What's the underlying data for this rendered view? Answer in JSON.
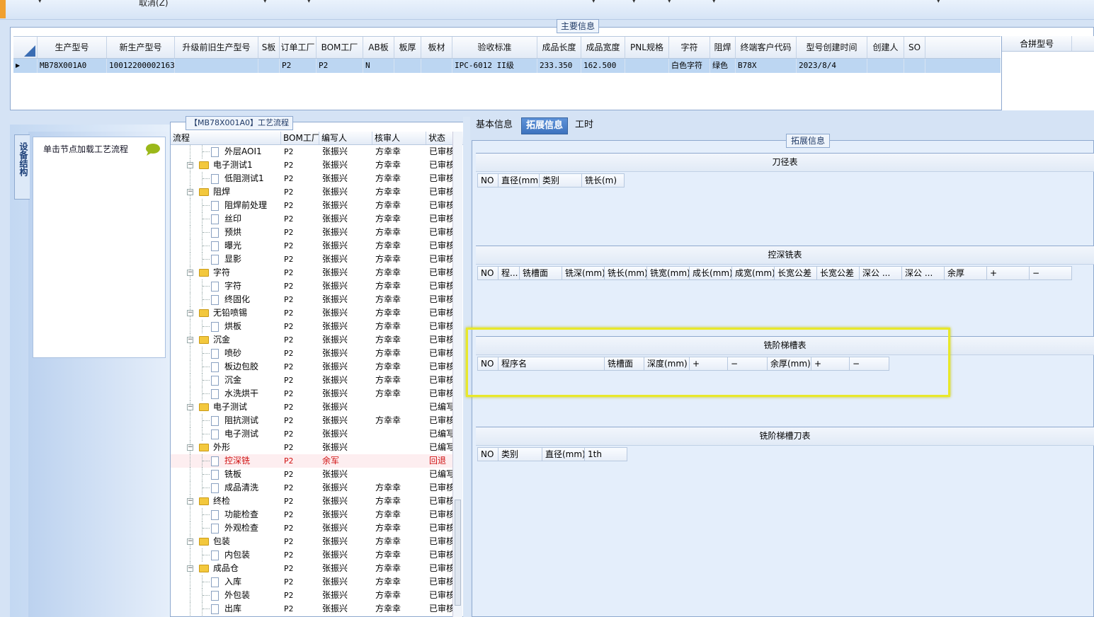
{
  "topbar": {
    "cancel_label": "取消(Z)"
  },
  "main_info": {
    "title": "主要信息",
    "columns": [
      "生产型号",
      "新生产型号",
      "升级前旧生产型号",
      "S板",
      "订单工厂",
      "BOM工厂",
      "AB板",
      "板厚",
      "板材",
      "验收标准",
      "成品长度",
      "成品宽度",
      "PNL规格",
      "字符",
      "阻焊",
      "终端客户代码",
      "型号创建时间",
      "创建人",
      "SO"
    ],
    "row": [
      "MB78X001A0",
      "10012200002163",
      "",
      "",
      "P2",
      "P2",
      "N",
      "",
      "",
      "IPC-6012 II级",
      "233.350",
      "162.500",
      "",
      "白色字符",
      "绿色",
      "B78X",
      "2023/8/4",
      "",
      ""
    ],
    "merge_header": "合拼型号"
  },
  "side": {
    "tab_label": "设备结构",
    "hint": "单击节点加载工艺流程"
  },
  "process": {
    "title": "【MB78X001A0】工艺流程",
    "columns": [
      "流程",
      "BOM工厂",
      "编写人",
      "核审人",
      "状态"
    ],
    "rows": [
      {
        "name": "外层AOI1",
        "level": 2,
        "type": "doc",
        "bom": "P2",
        "writer": "张振兴",
        "reviewer": "方幸幸",
        "status": "已审核"
      },
      {
        "name": "电子测试1",
        "level": 1,
        "type": "folder",
        "bom": "P2",
        "writer": "张振兴",
        "reviewer": "方幸幸",
        "status": "已审核"
      },
      {
        "name": "低阻测试1",
        "level": 2,
        "type": "doc",
        "bom": "P2",
        "writer": "张振兴",
        "reviewer": "方幸幸",
        "status": "已审核"
      },
      {
        "name": "阻焊",
        "level": 1,
        "type": "folder",
        "bom": "P2",
        "writer": "张振兴",
        "reviewer": "方幸幸",
        "status": "已审核"
      },
      {
        "name": "阻焊前处理",
        "level": 2,
        "type": "doc",
        "bom": "P2",
        "writer": "张振兴",
        "reviewer": "方幸幸",
        "status": "已审核"
      },
      {
        "name": "丝印",
        "level": 2,
        "type": "doc",
        "bom": "P2",
        "writer": "张振兴",
        "reviewer": "方幸幸",
        "status": "已审核"
      },
      {
        "name": "预烘",
        "level": 2,
        "type": "doc",
        "bom": "P2",
        "writer": "张振兴",
        "reviewer": "方幸幸",
        "status": "已审核"
      },
      {
        "name": "曝光",
        "level": 2,
        "type": "doc",
        "bom": "P2",
        "writer": "张振兴",
        "reviewer": "方幸幸",
        "status": "已审核"
      },
      {
        "name": "显影",
        "level": 2,
        "type": "doc",
        "bom": "P2",
        "writer": "张振兴",
        "reviewer": "方幸幸",
        "status": "已审核"
      },
      {
        "name": "字符",
        "level": 1,
        "type": "folder",
        "bom": "P2",
        "writer": "张振兴",
        "reviewer": "方幸幸",
        "status": "已审核"
      },
      {
        "name": "字符",
        "level": 2,
        "type": "doc",
        "bom": "P2",
        "writer": "张振兴",
        "reviewer": "方幸幸",
        "status": "已审核"
      },
      {
        "name": "终固化",
        "level": 2,
        "type": "doc",
        "bom": "P2",
        "writer": "张振兴",
        "reviewer": "方幸幸",
        "status": "已审核"
      },
      {
        "name": "无铅喷锡",
        "level": 1,
        "type": "folder",
        "bom": "P2",
        "writer": "张振兴",
        "reviewer": "方幸幸",
        "status": "已审核"
      },
      {
        "name": "烘板",
        "level": 2,
        "type": "doc",
        "bom": "P2",
        "writer": "张振兴",
        "reviewer": "方幸幸",
        "status": "已审核"
      },
      {
        "name": "沉金",
        "level": 1,
        "type": "folder",
        "bom": "P2",
        "writer": "张振兴",
        "reviewer": "方幸幸",
        "status": "已审核"
      },
      {
        "name": "喷砂",
        "level": 2,
        "type": "doc",
        "bom": "P2",
        "writer": "张振兴",
        "reviewer": "方幸幸",
        "status": "已审核"
      },
      {
        "name": "板边包胶",
        "level": 2,
        "type": "doc",
        "bom": "P2",
        "writer": "张振兴",
        "reviewer": "方幸幸",
        "status": "已审核"
      },
      {
        "name": "沉金",
        "level": 2,
        "type": "doc",
        "bom": "P2",
        "writer": "张振兴",
        "reviewer": "方幸幸",
        "status": "已审核"
      },
      {
        "name": "水洗烘干",
        "level": 2,
        "type": "doc",
        "bom": "P2",
        "writer": "张振兴",
        "reviewer": "方幸幸",
        "status": "已审核"
      },
      {
        "name": "电子测试",
        "level": 1,
        "type": "folder",
        "bom": "P2",
        "writer": "张振兴",
        "reviewer": "",
        "status": "已编写"
      },
      {
        "name": "阻抗测试",
        "level": 2,
        "type": "doc",
        "bom": "P2",
        "writer": "张振兴",
        "reviewer": "方幸幸",
        "status": "已审核"
      },
      {
        "name": "电子测试",
        "level": 2,
        "type": "doc",
        "bom": "P2",
        "writer": "张振兴",
        "reviewer": "",
        "status": "已编写"
      },
      {
        "name": "外形",
        "level": 1,
        "type": "folder",
        "bom": "P2",
        "writer": "张振兴",
        "reviewer": "",
        "status": "已编写"
      },
      {
        "name": "控深铣",
        "level": 2,
        "type": "doc",
        "bom": "P2",
        "writer": "余军",
        "reviewer": "",
        "status": "回退",
        "highlight": true
      },
      {
        "name": "铣板",
        "level": 2,
        "type": "doc",
        "bom": "P2",
        "writer": "张振兴",
        "reviewer": "",
        "status": "已编写"
      },
      {
        "name": "成品清洗",
        "level": 2,
        "type": "doc",
        "bom": "P2",
        "writer": "张振兴",
        "reviewer": "方幸幸",
        "status": "已审核"
      },
      {
        "name": "终检",
        "level": 1,
        "type": "folder",
        "bom": "P2",
        "writer": "张振兴",
        "reviewer": "方幸幸",
        "status": "已审核"
      },
      {
        "name": "功能检查",
        "level": 2,
        "type": "doc",
        "bom": "P2",
        "writer": "张振兴",
        "reviewer": "方幸幸",
        "status": "已审核"
      },
      {
        "name": "外观检查",
        "level": 2,
        "type": "doc",
        "bom": "P2",
        "writer": "张振兴",
        "reviewer": "方幸幸",
        "status": "已审核"
      },
      {
        "name": "包装",
        "level": 1,
        "type": "folder",
        "bom": "P2",
        "writer": "张振兴",
        "reviewer": "方幸幸",
        "status": "已审核"
      },
      {
        "name": "内包装",
        "level": 2,
        "type": "doc",
        "bom": "P2",
        "writer": "张振兴",
        "reviewer": "方幸幸",
        "status": "已审核"
      },
      {
        "name": "成品仓",
        "level": 1,
        "type": "folder",
        "bom": "P2",
        "writer": "张振兴",
        "reviewer": "方幸幸",
        "status": "已审核"
      },
      {
        "name": "入库",
        "level": 2,
        "type": "doc",
        "bom": "P2",
        "writer": "张振兴",
        "reviewer": "方幸幸",
        "status": "已审核"
      },
      {
        "name": "外包装",
        "level": 2,
        "type": "doc",
        "bom": "P2",
        "writer": "张振兴",
        "reviewer": "方幸幸",
        "status": "已审核"
      },
      {
        "name": "出库",
        "level": 2,
        "type": "doc",
        "bom": "P2",
        "writer": "张振兴",
        "reviewer": "方幸幸",
        "status": "已审核"
      }
    ]
  },
  "tabs": [
    "基本信息",
    "拓展信息",
    "工时"
  ],
  "ext": {
    "title": "拓展信息",
    "sections": [
      {
        "title": "刀径表",
        "columns": [
          "NO",
          "直径(mm)",
          "类别",
          "铣长(m)"
        ]
      },
      {
        "title": "控深铣表",
        "columns": [
          "NO",
          "程...",
          "铣槽面",
          "铣深(mm)",
          "铣长(mm)",
          "铣宽(mm)",
          "成长(mm)",
          "成宽(mm)",
          "长宽公差",
          "长宽公差",
          "深公 ...",
          "深公 ...",
          "余厚",
          "+",
          "−"
        ]
      },
      {
        "title": "铣阶梯槽表",
        "columns": [
          "NO",
          "程序名",
          "铣槽面",
          "深度(mm)",
          "+",
          "−",
          "余厚(mm)",
          "+",
          "−"
        ]
      },
      {
        "title": "铣阶梯槽刀表",
        "columns": [
          "NO",
          "类别",
          "直径(mm)",
          "1th"
        ]
      }
    ]
  }
}
